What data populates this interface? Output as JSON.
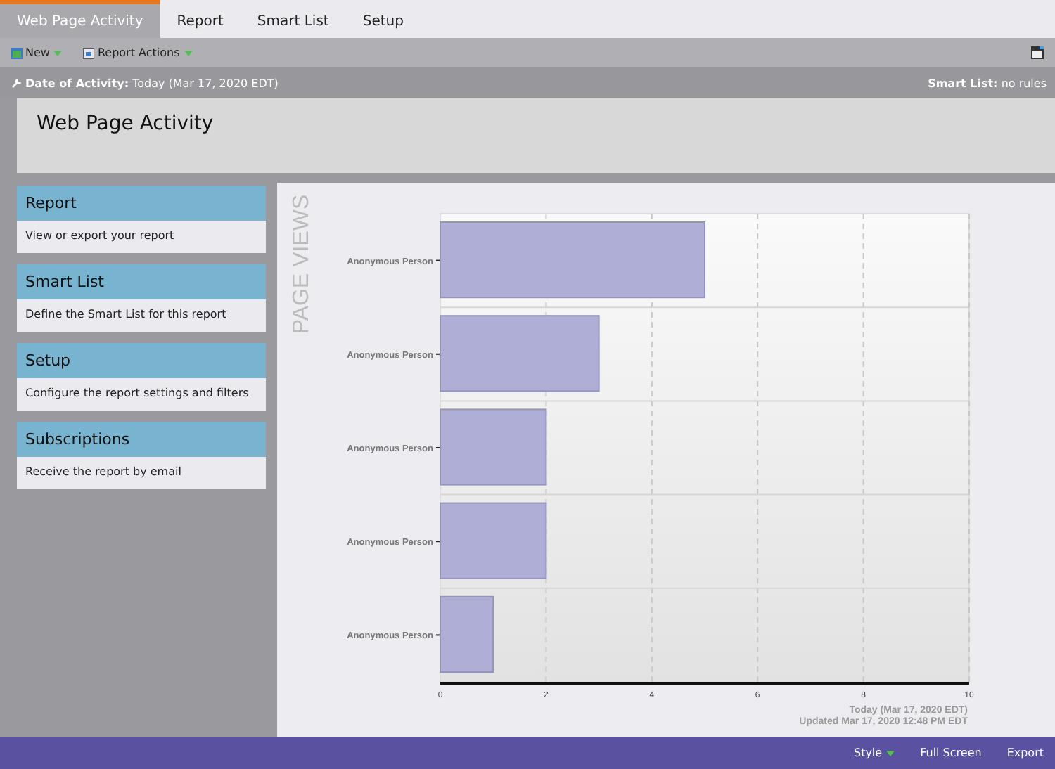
{
  "tabs": [
    {
      "label": "Web Page Activity",
      "selected": true
    },
    {
      "label": "Report",
      "selected": false
    },
    {
      "label": "Smart List",
      "selected": false
    },
    {
      "label": "Setup",
      "selected": false
    }
  ],
  "toolbar": [
    {
      "label": "New"
    },
    {
      "label": "Report Actions"
    }
  ],
  "filter_bar": {
    "left_label": "Date of Activity:",
    "left_value": "Today (Mar 17, 2020 EDT)",
    "right_label": "Smart List:",
    "right_value": "no rules"
  },
  "title": "Web Page Activity",
  "sidebar": [
    {
      "title": "Report",
      "description": "View or export your report"
    },
    {
      "title": "Smart List",
      "description": "Define the Smart List for this report"
    },
    {
      "title": "Setup",
      "description": "Configure the report settings and filters"
    },
    {
      "title": "Subscriptions",
      "description": "Receive the report by email"
    }
  ],
  "chart_data": {
    "type": "bar",
    "orientation": "horizontal",
    "ylabel": "PAGE VIEWS",
    "categories": [
      "Anonymous Person",
      "Anonymous Person",
      "Anonymous Person",
      "Anonymous Person",
      "Anonymous Person"
    ],
    "series": [
      {
        "color": "#aeaed6",
        "values": [
          5,
          3,
          2,
          2,
          1
        ]
      }
    ],
    "xlim": [
      0,
      10
    ],
    "xticks": [
      0,
      2,
      4,
      6,
      8,
      10
    ],
    "grid": true
  },
  "chart_notes": [
    "Today (Mar 17, 2020 EDT)",
    "Updated Mar 17, 2020 12:48 PM EDT"
  ],
  "footer_buttons": [
    {
      "label": "Style",
      "dropdown": true
    },
    {
      "label": "Full Screen",
      "dropdown": false
    },
    {
      "label": "Export",
      "dropdown": false
    }
  ]
}
